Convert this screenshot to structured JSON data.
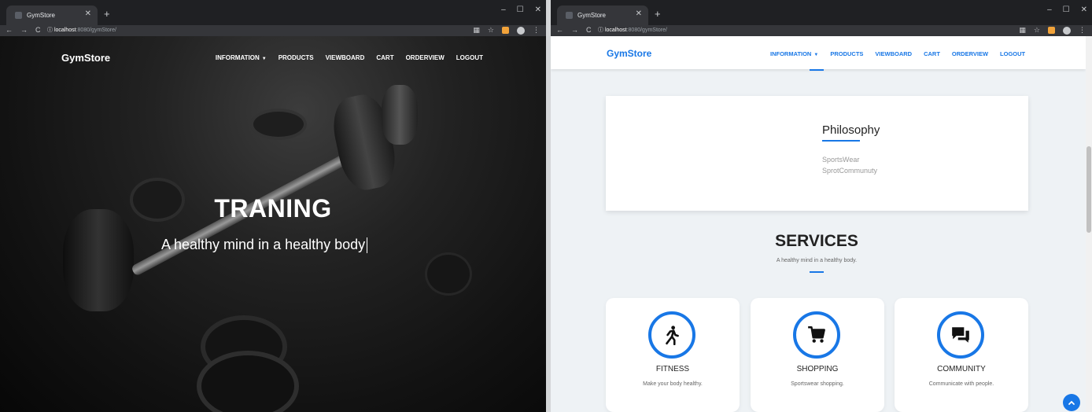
{
  "left_window": {
    "tab_title": "GymStore",
    "address_host": "localhost",
    "address_path": ":8080/gymStore/",
    "navbar": {
      "brand": "GymStore",
      "items": [
        "INFORMATION",
        "PRODUCTS",
        "VIEWBOARD",
        "CART",
        "ORDERVIEW",
        "LOGOUT"
      ]
    },
    "hero": {
      "title": "TRANING",
      "subtitle": "A healthy mind in a healthy body"
    }
  },
  "right_window": {
    "tab_title": "GymStore",
    "address_host": "localhost",
    "address_path": ":8080/gymStore/",
    "navbar": {
      "brand": "GymStore",
      "items": [
        "INFORMATION",
        "PRODUCTS",
        "VIEWBOARD",
        "CART",
        "ORDERVIEW",
        "LOGOUT"
      ]
    },
    "philosophy": {
      "title": "Philosophy",
      "items": [
        "SportsWear",
        "SprotCommunuty"
      ]
    },
    "services": {
      "title": "SERVICES",
      "subtitle": "A healthy mind in a healthy body.",
      "cards": [
        {
          "icon": "walking-person-icon",
          "title": "FITNESS",
          "desc": "Make your body healthy."
        },
        {
          "icon": "shopping-cart-icon",
          "title": "SHOPPING",
          "desc": "Sportswear shopping."
        },
        {
          "icon": "chat-bubbles-icon",
          "title": "COMMUNITY",
          "desc": "Communicate with people."
        }
      ]
    }
  },
  "colors": {
    "accent": "#1877e6",
    "chrome_dark": "#1f2023",
    "page_bg": "#eef2f5"
  }
}
